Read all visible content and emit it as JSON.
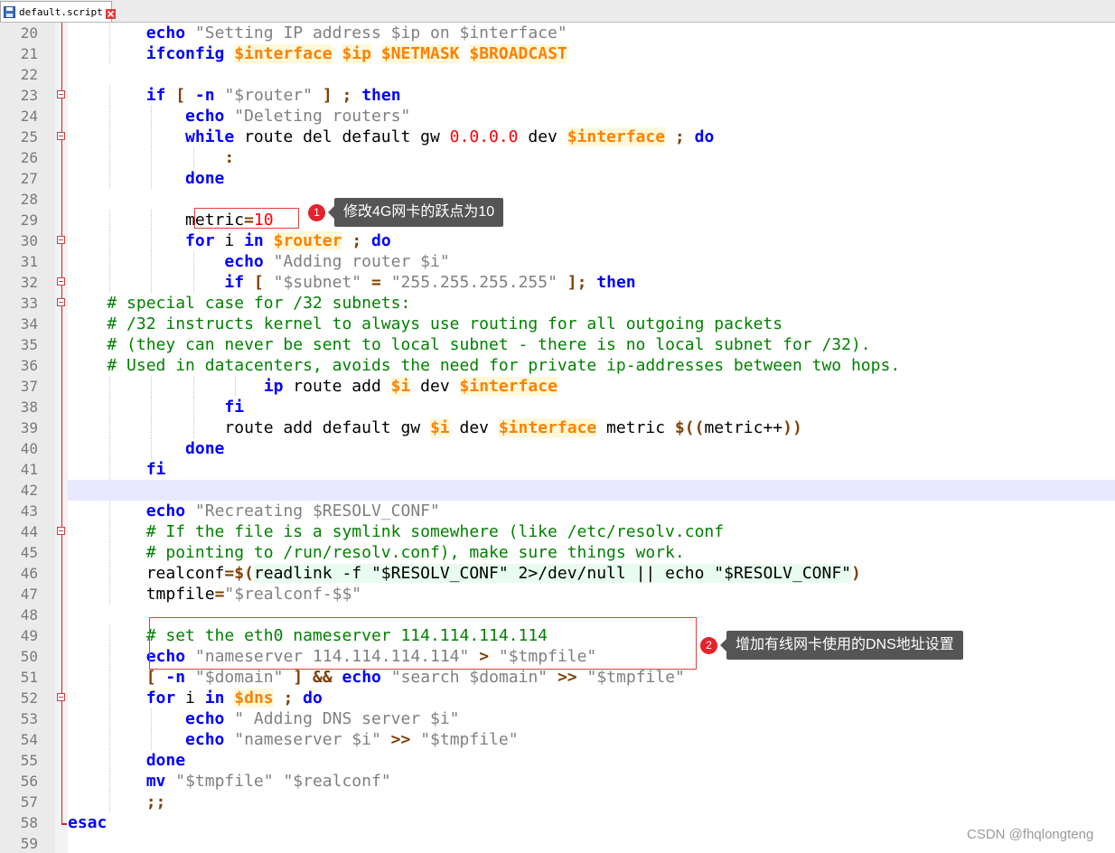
{
  "tab": {
    "label": "default.script"
  },
  "editor": {
    "first_line_number": 20,
    "current_line": 42,
    "fold_markers": [
      23,
      25,
      30,
      32,
      33,
      44,
      52
    ],
    "lines": [
      [
        [
          "        ",
          "tx"
        ],
        [
          "echo",
          "kw"
        ],
        [
          " ",
          "tx"
        ],
        [
          "\"Setting IP address $ip on $interface\"",
          "str"
        ]
      ],
      [
        [
          "        ",
          "tx"
        ],
        [
          "ifconfig",
          "kw"
        ],
        [
          " ",
          "tx"
        ],
        [
          "$interface",
          "var"
        ],
        [
          " ",
          "tx"
        ],
        [
          "$ip",
          "var"
        ],
        [
          " ",
          "tx"
        ],
        [
          "$NETMASK",
          "var"
        ],
        [
          " ",
          "tx"
        ],
        [
          "$BROADCAST",
          "var"
        ]
      ],
      [],
      [
        [
          "        ",
          "tx"
        ],
        [
          "if",
          "kw"
        ],
        [
          " ",
          "tx"
        ],
        [
          "[",
          "op"
        ],
        [
          " ",
          "tx"
        ],
        [
          "-n",
          "kw"
        ],
        [
          " ",
          "tx"
        ],
        [
          "\"$router\"",
          "str"
        ],
        [
          " ",
          "tx"
        ],
        [
          "]",
          "op"
        ],
        [
          " ",
          "tx"
        ],
        [
          ";",
          "op"
        ],
        [
          " ",
          "tx"
        ],
        [
          "then",
          "kw"
        ]
      ],
      [
        [
          "            ",
          "tx"
        ],
        [
          "echo",
          "kw"
        ],
        [
          " ",
          "tx"
        ],
        [
          "\"Deleting routers\"",
          "str"
        ]
      ],
      [
        [
          "            ",
          "tx"
        ],
        [
          "while",
          "kw"
        ],
        [
          " route del default gw ",
          "tx"
        ],
        [
          "0.0.0.0",
          "num"
        ],
        [
          " dev ",
          "tx"
        ],
        [
          "$interface",
          "var"
        ],
        [
          " ",
          "tx"
        ],
        [
          ";",
          "op"
        ],
        [
          " ",
          "tx"
        ],
        [
          "do",
          "kw"
        ]
      ],
      [
        [
          "                ",
          "tx"
        ],
        [
          ":",
          "op"
        ]
      ],
      [
        [
          "            ",
          "tx"
        ],
        [
          "done",
          "kw"
        ]
      ],
      [],
      [
        [
          "            ",
          "tx"
        ],
        [
          "metric",
          "tx"
        ],
        [
          "=",
          "op"
        ],
        [
          "10",
          "num"
        ]
      ],
      [
        [
          "            ",
          "tx"
        ],
        [
          "for",
          "kw"
        ],
        [
          " i ",
          "tx"
        ],
        [
          "in",
          "kw"
        ],
        [
          " ",
          "tx"
        ],
        [
          "$router",
          "var"
        ],
        [
          " ",
          "tx"
        ],
        [
          ";",
          "op"
        ],
        [
          " ",
          "tx"
        ],
        [
          "do",
          "kw"
        ]
      ],
      [
        [
          "                ",
          "tx"
        ],
        [
          "echo",
          "kw"
        ],
        [
          " ",
          "tx"
        ],
        [
          "\"Adding router $i\"",
          "str"
        ]
      ],
      [
        [
          "                ",
          "tx"
        ],
        [
          "if",
          "kw"
        ],
        [
          " ",
          "tx"
        ],
        [
          "[",
          "op"
        ],
        [
          " ",
          "tx"
        ],
        [
          "\"$subnet\"",
          "str"
        ],
        [
          " ",
          "tx"
        ],
        [
          "=",
          "op"
        ],
        [
          " ",
          "tx"
        ],
        [
          "\"255.255.255.255\"",
          "str"
        ],
        [
          " ",
          "tx"
        ],
        [
          "];",
          "op"
        ],
        [
          " ",
          "tx"
        ],
        [
          "then",
          "kw"
        ]
      ],
      [
        [
          "    ",
          "tx"
        ],
        [
          "# special case for /32 subnets:",
          "cm"
        ]
      ],
      [
        [
          "    ",
          "tx"
        ],
        [
          "# /32 instructs kernel to always use routing for all outgoing packets",
          "cm"
        ]
      ],
      [
        [
          "    ",
          "tx"
        ],
        [
          "# (they can never be sent to local subnet - there is no local subnet for /32).",
          "cm"
        ]
      ],
      [
        [
          "    ",
          "tx"
        ],
        [
          "# Used in datacenters, avoids the need for private ip-addresses between two hops.",
          "cm"
        ]
      ],
      [
        [
          "                    ",
          "tx"
        ],
        [
          "ip",
          "kw"
        ],
        [
          " route add ",
          "tx"
        ],
        [
          "$i",
          "var"
        ],
        [
          " dev ",
          "tx"
        ],
        [
          "$interface",
          "var"
        ]
      ],
      [
        [
          "                ",
          "tx"
        ],
        [
          "fi",
          "kw"
        ]
      ],
      [
        [
          "                ",
          "tx"
        ],
        [
          "route add default gw ",
          "tx"
        ],
        [
          "$i",
          "var"
        ],
        [
          " dev ",
          "tx"
        ],
        [
          "$interface",
          "var"
        ],
        [
          " metric ",
          "tx"
        ],
        [
          "$((",
          "op"
        ],
        [
          "metric++",
          "tx"
        ],
        [
          "))",
          "op"
        ]
      ],
      [
        [
          "            ",
          "tx"
        ],
        [
          "done",
          "kw"
        ]
      ],
      [
        [
          "        ",
          "tx"
        ],
        [
          "fi",
          "kw"
        ]
      ],
      [],
      [
        [
          "        ",
          "tx"
        ],
        [
          "echo",
          "kw"
        ],
        [
          " ",
          "tx"
        ],
        [
          "\"Recreating $RESOLV_CONF\"",
          "str"
        ]
      ],
      [
        [
          "        ",
          "tx"
        ],
        [
          "# If the file is a symlink somewhere (like /etc/resolv.conf",
          "cm"
        ]
      ],
      [
        [
          "        ",
          "tx"
        ],
        [
          "# pointing to /run/resolv.conf), make sure things work.",
          "cm"
        ]
      ],
      [
        [
          "        ",
          "tx"
        ],
        [
          "realconf",
          "tx"
        ],
        [
          "=$(",
          "op"
        ],
        [
          "readlink -f ",
          "sub"
        ],
        [
          "\"$RESOLV_CONF\"",
          "sub"
        ],
        [
          " 2>/dev/null || ",
          "sub"
        ],
        [
          "echo",
          "sub"
        ],
        [
          " ",
          "sub"
        ],
        [
          "\"$RESOLV_CONF\"",
          "sub"
        ],
        [
          ")",
          "op"
        ]
      ],
      [
        [
          "        ",
          "tx"
        ],
        [
          "tmpfile",
          "tx"
        ],
        [
          "=",
          "op"
        ],
        [
          "\"$realconf-$$\"",
          "str"
        ]
      ],
      [],
      [
        [
          "        ",
          "tx"
        ],
        [
          "# set the eth0 nameserver 114.114.114.114",
          "cm"
        ]
      ],
      [
        [
          "        ",
          "tx"
        ],
        [
          "echo",
          "kw"
        ],
        [
          " ",
          "tx"
        ],
        [
          "\"nameserver 114.114.114.114\"",
          "str"
        ],
        [
          " ",
          "tx"
        ],
        [
          ">",
          "op"
        ],
        [
          " ",
          "tx"
        ],
        [
          "\"$tmpfile\"",
          "str"
        ]
      ],
      [
        [
          "        ",
          "tx"
        ],
        [
          "[",
          "op"
        ],
        [
          " ",
          "tx"
        ],
        [
          "-n",
          "kw"
        ],
        [
          " ",
          "tx"
        ],
        [
          "\"$domain\"",
          "str"
        ],
        [
          " ",
          "tx"
        ],
        [
          "]",
          "op"
        ],
        [
          " ",
          "tx"
        ],
        [
          "&&",
          "op"
        ],
        [
          " ",
          "tx"
        ],
        [
          "echo",
          "kw"
        ],
        [
          " ",
          "tx"
        ],
        [
          "\"search $domain\"",
          "str"
        ],
        [
          " ",
          "tx"
        ],
        [
          ">>",
          "op"
        ],
        [
          " ",
          "tx"
        ],
        [
          "\"$tmpfile\"",
          "str"
        ]
      ],
      [
        [
          "        ",
          "tx"
        ],
        [
          "for",
          "kw"
        ],
        [
          " i ",
          "tx"
        ],
        [
          "in",
          "kw"
        ],
        [
          " ",
          "tx"
        ],
        [
          "$dns",
          "var"
        ],
        [
          " ",
          "tx"
        ],
        [
          ";",
          "op"
        ],
        [
          " ",
          "tx"
        ],
        [
          "do",
          "kw"
        ]
      ],
      [
        [
          "            ",
          "tx"
        ],
        [
          "echo",
          "kw"
        ],
        [
          " ",
          "tx"
        ],
        [
          "\" Adding DNS server $i\"",
          "str"
        ]
      ],
      [
        [
          "            ",
          "tx"
        ],
        [
          "echo",
          "kw"
        ],
        [
          " ",
          "tx"
        ],
        [
          "\"nameserver $i\"",
          "str"
        ],
        [
          " ",
          "tx"
        ],
        [
          ">>",
          "op"
        ],
        [
          " ",
          "tx"
        ],
        [
          "\"$tmpfile\"",
          "str"
        ]
      ],
      [
        [
          "        ",
          "tx"
        ],
        [
          "done",
          "kw"
        ]
      ],
      [
        [
          "        ",
          "tx"
        ],
        [
          "mv",
          "kw"
        ],
        [
          " ",
          "tx"
        ],
        [
          "\"$tmpfile\"",
          "str"
        ],
        [
          " ",
          "tx"
        ],
        [
          "\"$realconf\"",
          "str"
        ]
      ],
      [
        [
          "        ",
          "tx"
        ],
        [
          ";;",
          "op"
        ]
      ],
      [
        [
          "esac",
          "kw"
        ]
      ],
      []
    ]
  },
  "annotations": [
    {
      "number": "1",
      "text": "修改4G网卡的跃点为10"
    },
    {
      "number": "2",
      "text": "增加有线网卡使用的DNS地址设置"
    }
  ],
  "watermark": "CSDN @fhqlongteng",
  "colors": {
    "keyword": "#0000ff",
    "variable": "#ff8000",
    "string": "#808080",
    "number": "#ff0000",
    "comment": "#008000",
    "operator": "#804000",
    "annotation_badge": "#e5222b",
    "annotation_box": "#e0403a",
    "callout_bg": "#555555"
  },
  "icons": {
    "tab_file": "floppy-disk-icon",
    "tab_close": "close-icon"
  }
}
